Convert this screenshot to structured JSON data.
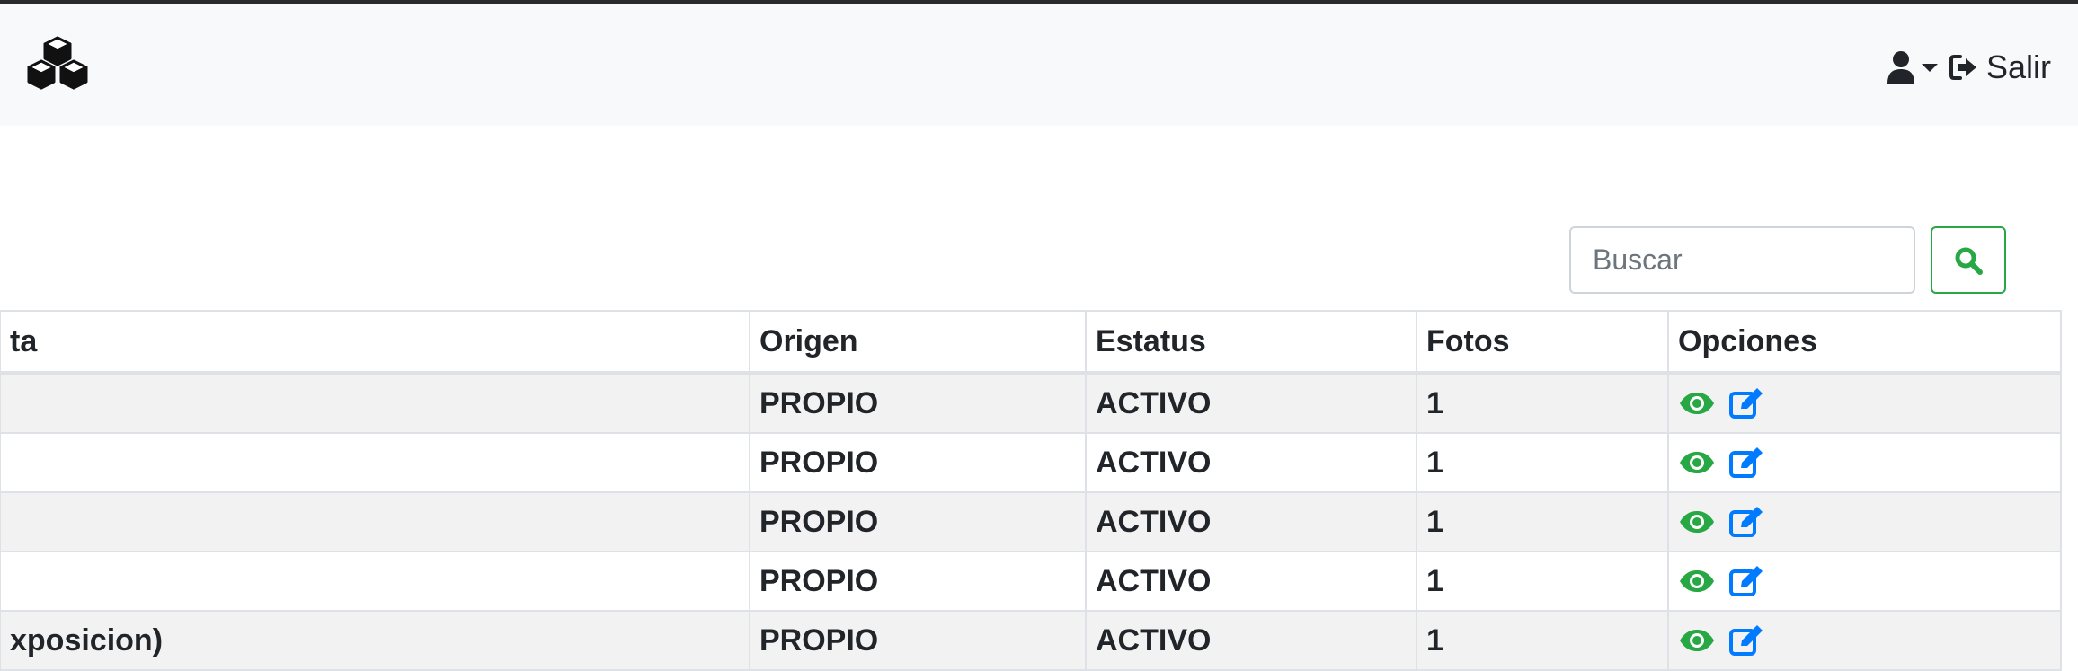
{
  "navbar": {
    "brand_icon": "cubes-icon",
    "user_icon": "user-icon",
    "caret_icon": "caret-down-icon",
    "logout_icon": "sign-out-icon",
    "logout_label": "Salir"
  },
  "search": {
    "placeholder": "Buscar",
    "value": "",
    "button_icon": "search-icon",
    "accent": "#28a745"
  },
  "table": {
    "columns": [
      "ta",
      "Origen",
      "Estatus",
      "Fotos",
      "Opciones"
    ],
    "rows": [
      {
        "first": "",
        "origen": "PROPIO",
        "estatus": "ACTIVO",
        "fotos": "1"
      },
      {
        "first": "",
        "origen": "PROPIO",
        "estatus": "ACTIVO",
        "fotos": "1"
      },
      {
        "first": "",
        "origen": "PROPIO",
        "estatus": "ACTIVO",
        "fotos": "1"
      },
      {
        "first": "",
        "origen": "PROPIO",
        "estatus": "ACTIVO",
        "fotos": "1"
      },
      {
        "first": "xposicion)",
        "origen": "PROPIO",
        "estatus": "ACTIVO",
        "fotos": "1"
      }
    ],
    "row_icons": [
      "eye-icon",
      "edit-icon"
    ],
    "colors": {
      "view": "#28a745",
      "edit": "#007bff",
      "stripe": "#f2f2f2"
    }
  }
}
